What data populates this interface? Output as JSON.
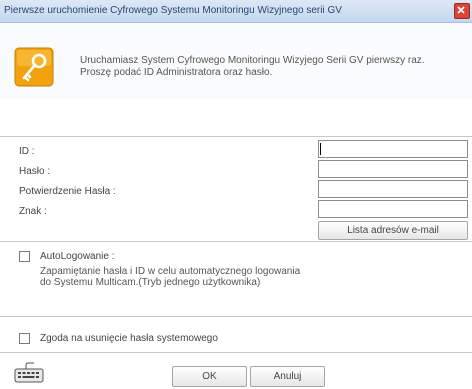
{
  "window": {
    "title": "Pierwsze uruchomienie Cyfrowego Systemu Monitoringu Wizyjnego serii GV"
  },
  "header": {
    "line1": "Uruchamiasz System Cyfrowego Monitoringu Wizyjego Serii GV pierwszy raz.",
    "line2": "Proszę podać ID Administratora oraz hasło.",
    "icon": "key-icon"
  },
  "form": {
    "id_label": "ID :",
    "password_label": "Hasło :",
    "confirm_label": "Potwierdzenie Hasła :",
    "hint_label": "Znak :",
    "id_value": "",
    "password_value": "",
    "confirm_value": "",
    "hint_value": ""
  },
  "email_button_label": "Lista adresów e-mail",
  "autologin": {
    "label": "AutoLogowanie :",
    "description": "Zapamiętanie hasła i ID w celu automatycznego logowania do Systemu Multicam.(Tryb jednego użytkownika)",
    "checked": false
  },
  "remove_password": {
    "label": "Zgoda na usunięcie hasła systemowego",
    "checked": false
  },
  "buttons": {
    "ok": "OK",
    "cancel": "Anuluj"
  },
  "colors": {
    "titlebar": "#c4d7ef",
    "icon_orange": "#f2a20c",
    "close_red": "#d8463b"
  },
  "footer_icon": "keyboard-icon"
}
